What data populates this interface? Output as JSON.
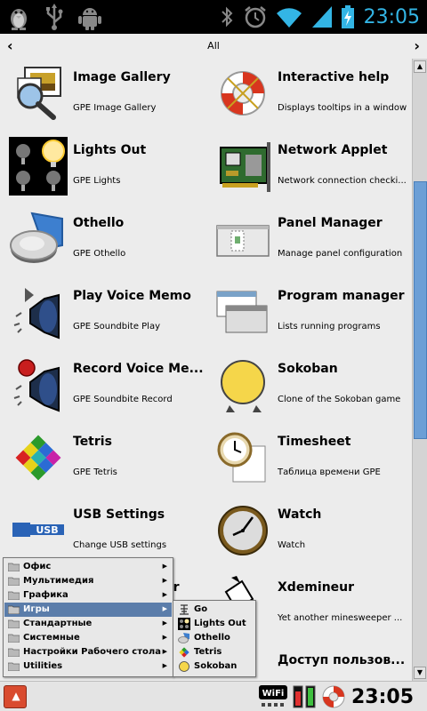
{
  "status_bar": {
    "time": "23:05",
    "icons": [
      "penguin-icon",
      "usb-icon",
      "android-debug-icon",
      "bluetooth-icon",
      "alarm-icon",
      "wifi-icon",
      "signal-icon",
      "battery-charging-icon"
    ]
  },
  "category": {
    "title": "All",
    "prev": "‹",
    "next": "›"
  },
  "apps": [
    {
      "name": "Image Gallery",
      "desc": "GPE Image Gallery",
      "icon": "image-gallery-icon"
    },
    {
      "name": "Interactive help",
      "desc": "Displays tooltips in a window",
      "icon": "lifebuoy-icon"
    },
    {
      "name": "Lights Out",
      "desc": "GPE Lights",
      "icon": "lights-out-icon"
    },
    {
      "name": "Network Applet",
      "desc": "Network connection checki...",
      "icon": "network-card-icon"
    },
    {
      "name": "Othello",
      "desc": "GPE Othello",
      "icon": "othello-icon"
    },
    {
      "name": "Panel Manager",
      "desc": "Manage panel configuration",
      "icon": "panel-manager-icon"
    },
    {
      "name": "Play Voice Memo",
      "desc": "GPE Soundbite Play",
      "icon": "play-memo-icon"
    },
    {
      "name": "Program manager",
      "desc": "Lists running programs",
      "icon": "program-manager-icon"
    },
    {
      "name": "Record Voice Me...",
      "desc": "GPE Soundbite Record",
      "icon": "record-memo-icon"
    },
    {
      "name": "Sokoban",
      "desc": "Clone of the Sokoban game",
      "icon": "sokoban-icon"
    },
    {
      "name": "Tetris",
      "desc": "GPE Tetris",
      "icon": "tetris-icon"
    },
    {
      "name": "Timesheet",
      "desc": "Таблица времени GPE",
      "icon": "timesheet-icon"
    },
    {
      "name": "USB Settings",
      "desc": "Change USB settings",
      "icon": "usb-settings-icon"
    },
    {
      "name": "Watch",
      "desc": "Watch",
      "icon": "watch-icon"
    },
    {
      "name": "or",
      "desc": "",
      "icon": ""
    },
    {
      "name": "Xdemineur",
      "desc": "Yet another minesweeper ...",
      "icon": "xdemineur-icon"
    },
    {
      "name": "",
      "desc": "",
      "icon": ""
    },
    {
      "name": "Доступ пользов...",
      "desc": "",
      "icon": ""
    }
  ],
  "start_menu": {
    "items": [
      {
        "label": "Офис",
        "selected": false
      },
      {
        "label": "Мультимедия",
        "selected": false
      },
      {
        "label": "Графика",
        "selected": false
      },
      {
        "label": "Игры",
        "selected": true
      },
      {
        "label": "Стандартные",
        "selected": false
      },
      {
        "label": "Системные",
        "selected": false
      },
      {
        "label": "Настройки Рабочего стола",
        "selected": false
      },
      {
        "label": "Utilities",
        "selected": false
      }
    ],
    "submenu": [
      {
        "label": "Go",
        "icon": "go-icon"
      },
      {
        "label": "Lights Out",
        "icon": "lights-out-icon"
      },
      {
        "label": "Othello",
        "icon": "othello-icon"
      },
      {
        "label": "Tetris",
        "icon": "tetris-icon"
      },
      {
        "label": "Sokoban",
        "icon": "sokoban-icon"
      }
    ]
  },
  "taskbar": {
    "start_icon": "start-menu-icon",
    "clock": "23:05",
    "wifi_label": "WiFi"
  },
  "colors": {
    "status_time": "#33b5e5",
    "menu_selected": "#5b7daa",
    "scroll_thumb": "#6c9fd6",
    "start_button": "#d94b2f"
  }
}
